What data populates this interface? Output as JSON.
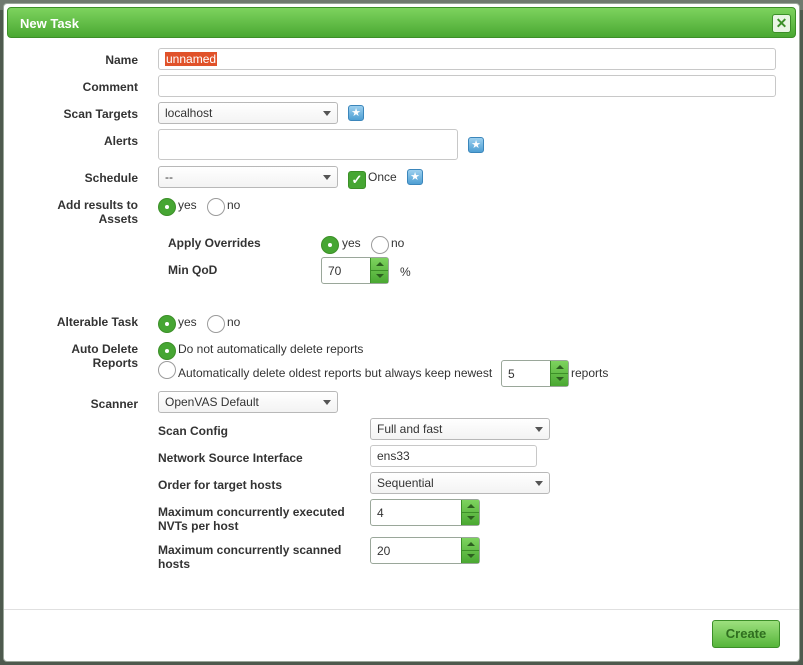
{
  "dialog": {
    "title": "New Task",
    "close_symbol": "✕"
  },
  "form": {
    "name": {
      "label": "Name",
      "value": "unnamed"
    },
    "comment": {
      "label": "Comment",
      "value": ""
    },
    "scan_targets": {
      "label": "Scan Targets",
      "selected": "localhost"
    },
    "alerts": {
      "label": "Alerts"
    },
    "schedule": {
      "label": "Schedule",
      "selected": "--",
      "once_label": "Once"
    },
    "add_results": {
      "label_line1": "Add results to",
      "label_line2": "Assets",
      "yes": "yes",
      "no": "no",
      "selected": "yes"
    },
    "apply_overrides": {
      "label": "Apply Overrides",
      "yes": "yes",
      "no": "no",
      "selected": "yes"
    },
    "min_qod": {
      "label": "Min QoD",
      "value": "70",
      "unit": "%"
    },
    "alterable": {
      "label": "Alterable Task",
      "yes": "yes",
      "no": "no",
      "selected": "yes"
    },
    "auto_delete": {
      "label_line1": "Auto Delete",
      "label_line2": "Reports",
      "option1": "Do not automatically delete reports",
      "option2": "Automatically delete oldest reports but always keep newest",
      "keep_value": "5",
      "keep_unit": "reports",
      "selected": "option1"
    },
    "scanner": {
      "label": "Scanner",
      "selected": "OpenVAS Default"
    },
    "scan_config": {
      "label": "Scan Config",
      "selected": "Full and fast"
    },
    "network_source": {
      "label": "Network Source Interface",
      "value": "ens33"
    },
    "order_hosts": {
      "label": "Order for target hosts",
      "selected": "Sequential"
    },
    "max_nvts": {
      "label_line1": "Maximum concurrently executed",
      "label_line2": "NVTs per host",
      "value": "4"
    },
    "max_hosts": {
      "label_line1": "Maximum concurrently scanned",
      "label_line2": "hosts",
      "value": "20"
    }
  },
  "footer": {
    "create_label": "Create"
  },
  "icons": {
    "new_target": "star-icon",
    "new_alert": "star-icon",
    "new_schedule": "star-icon"
  },
  "colors": {
    "accent_green": "#46a633",
    "title_green": "#5cbf3f",
    "star_blue": "#4f9fd3",
    "highlight": "#e0522a"
  }
}
